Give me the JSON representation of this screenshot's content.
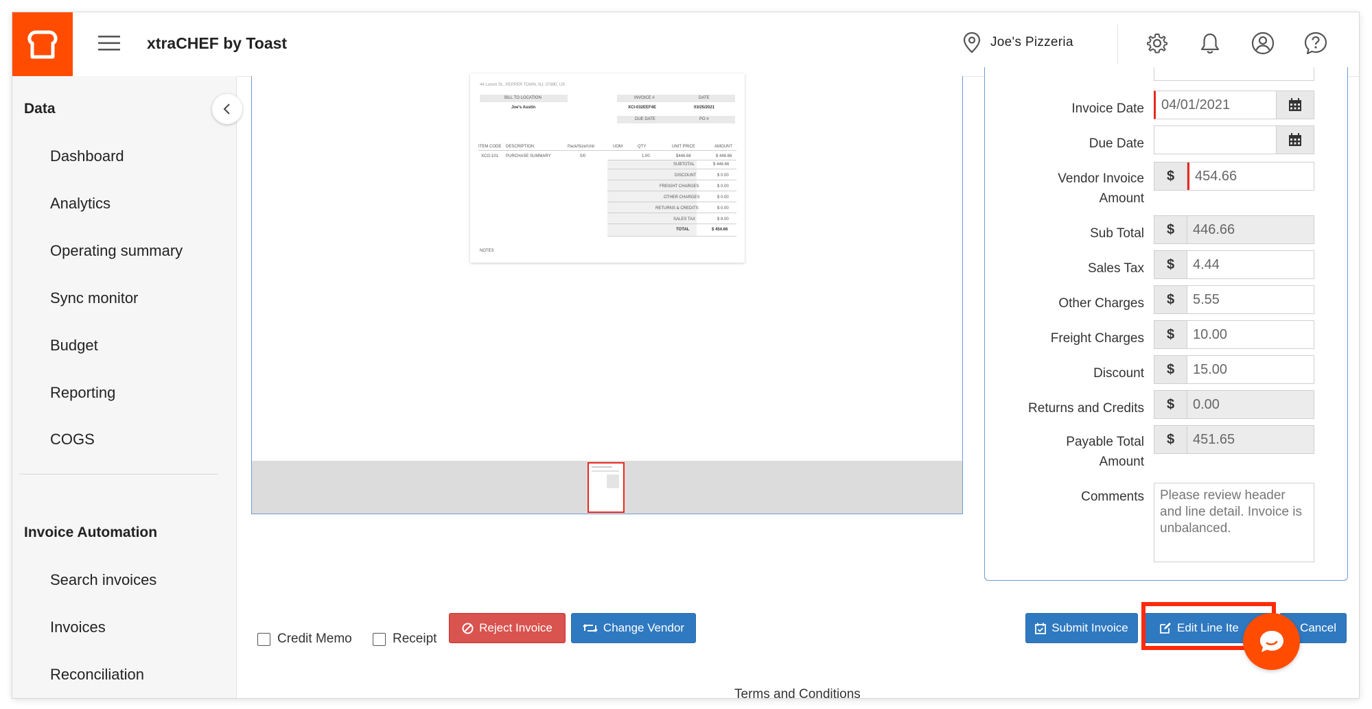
{
  "header": {
    "app_title": "xtraCHEF by Toast",
    "location_name": "Joe's Pizzeria",
    "icons": [
      "toast-logo-icon",
      "hamburger-menu-icon",
      "location-pin-icon",
      "settings-gear-icon",
      "notification-bell-icon",
      "user-account-icon",
      "help-question-icon"
    ]
  },
  "sidebar": {
    "data_section": {
      "title": "Data",
      "items": [
        {
          "label": "Dashboard"
        },
        {
          "label": "Analytics"
        },
        {
          "label": "Operating summary"
        },
        {
          "label": "Sync monitor"
        },
        {
          "label": "Budget"
        },
        {
          "label": "Reporting"
        },
        {
          "label": "COGS"
        }
      ]
    },
    "invoice_section": {
      "title": "Invoice Automation",
      "items": [
        {
          "label": "Search invoices"
        },
        {
          "label": "Invoices"
        },
        {
          "label": "Reconciliation"
        }
      ]
    }
  },
  "document": {
    "address": "44 Lorem St., PEPPER TOWN, NJ, 07890, US",
    "bill_to_header": "BILL TO LOCATION",
    "bill_to_value": "Joe's Austin",
    "invoice_no_header": "INVOICE #",
    "invoice_no_value": "XCI-032EEF4E",
    "date_header": "DATE",
    "date_value": "03/25/2021",
    "due_date_header": "DUE DATE",
    "po_header": "PO #",
    "columns": [
      "ITEM CODE",
      "DESCRIPTION",
      "Pack/Size/Unit",
      "UOM",
      "QTY",
      "UNIT PRICE",
      "AMOUNT"
    ],
    "row": [
      "XCG-101",
      "PURCHASE SUMMARY",
      "0/0",
      "",
      "1.00",
      "$446.66",
      "$ 446.66"
    ],
    "totals": [
      {
        "label": "SUBTOTAL",
        "value": "$ 446.66"
      },
      {
        "label": "DISCOUNT",
        "value": "$ 0.00"
      },
      {
        "label": "FREIGHT CHARGES",
        "value": "$ 0.00"
      },
      {
        "label": "OTHER CHARGES",
        "value": "$ 0.00"
      },
      {
        "label": "RETURNS & CREDITS",
        "value": "$ 0.00"
      },
      {
        "label": "SALES TAX",
        "value": "$ 8.00"
      },
      {
        "label": "TOTAL",
        "value": "$ 454.66"
      }
    ],
    "notes": "NOTES"
  },
  "form": {
    "invoice_date": {
      "label": "Invoice Date",
      "value": "04/01/2021"
    },
    "due_date": {
      "label": "Due Date",
      "value": ""
    },
    "vendor_invoice_amount": {
      "label1": "Vendor Invoice",
      "label2": "Amount",
      "value": "454.66"
    },
    "sub_total": {
      "label": "Sub Total",
      "value": "446.66"
    },
    "sales_tax": {
      "label": "Sales Tax",
      "value": "4.44"
    },
    "other_charges": {
      "label": "Other Charges",
      "value": "5.55"
    },
    "freight_charges": {
      "label": "Freight Charges",
      "value": "10.00"
    },
    "discount": {
      "label": "Discount",
      "value": "15.00"
    },
    "returns_credits": {
      "label": "Returns and Credits",
      "value": "0.00"
    },
    "payable_total": {
      "label1": "Payable Total",
      "label2": "Amount",
      "value": "451.65"
    },
    "comments": {
      "label": "Comments",
      "value": "Please review header and line detail. Invoice is unbalanced."
    },
    "currency_symbol": "$"
  },
  "actions": {
    "credit_memo": "Credit Memo",
    "receipt": "Receipt",
    "reject_invoice": "Reject Invoice",
    "change_vendor": "Change Vendor",
    "submit_invoice": "Submit Invoice",
    "edit_line_items": "Edit Line Ite",
    "cancel": "Cancel"
  },
  "footer": {
    "terms": "Terms and Conditions"
  },
  "colors": {
    "brand_orange": "#ff4c00",
    "primary_blue": "#2f79c0",
    "danger_red": "#d9534f",
    "highlight_red": "#ff2a0a"
  }
}
